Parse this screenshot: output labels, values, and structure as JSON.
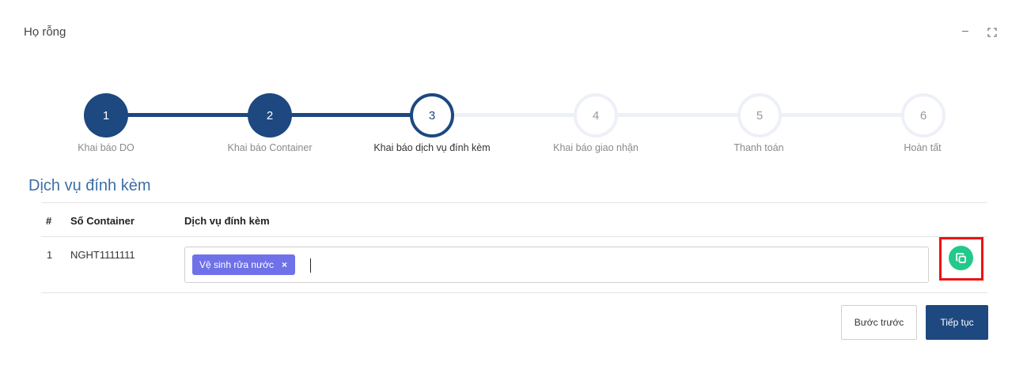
{
  "panel": {
    "title": "Họ rỗng",
    "minimize_symbol": "–"
  },
  "steps": [
    {
      "number": "1",
      "label": "Khai báo DO",
      "state": "done"
    },
    {
      "number": "2",
      "label": "Khai báo Container",
      "state": "done"
    },
    {
      "number": "3",
      "label": "Khai báo dịch vụ đính kèm",
      "state": "active"
    },
    {
      "number": "4",
      "label": "Khai báo giao nhận",
      "state": "todo"
    },
    {
      "number": "5",
      "label": "Thanh toán",
      "state": "todo"
    },
    {
      "number": "6",
      "label": "Hoàn tất",
      "state": "todo"
    }
  ],
  "section": {
    "title": "Dịch vụ đính kèm"
  },
  "table": {
    "headers": [
      "#",
      "Số Container",
      "Dịch vụ đính kèm"
    ],
    "rows": [
      {
        "index": "1",
        "container": "NGHT1111111",
        "services": [
          {
            "label": "Vệ sinh rửa nước",
            "remove": "×"
          }
        ]
      }
    ]
  },
  "actions": {
    "back_label": "Bước trước",
    "next_label": "Tiếp tục",
    "copy_icon": "copy-icon"
  },
  "colors": {
    "primary": "#1d4880",
    "inactive": "#eef0f8",
    "tag": "#6f71e8",
    "copy": "#22c98a",
    "highlight": "#ee1111",
    "section_title": "#3b6fa5"
  }
}
